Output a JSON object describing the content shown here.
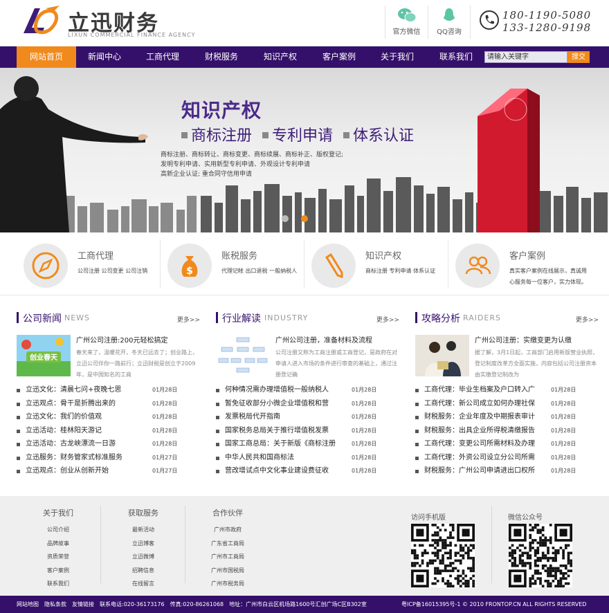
{
  "header": {
    "logo_title": "立迅财务",
    "logo_sub": "LIXUN COMMERCIAL FINANCE AGENCY",
    "wechat_label": "官方微信",
    "qq_label": "QQ咨询",
    "phone1": "180-1190-5080",
    "phone2": "133-1280-9198"
  },
  "nav": {
    "items": [
      "网站首页",
      "新闻中心",
      "工商代理",
      "财税服务",
      "知识产权",
      "客户案例",
      "关于我们",
      "联系我们"
    ],
    "search_placeholder": "请输入关键字",
    "search_button": "搜交"
  },
  "banner": {
    "title": "知识产权",
    "subtitle_items": [
      "商标注册",
      "专利申请",
      "体系认证"
    ],
    "lines": [
      "商标注册、商标转让、商标变更、商标续展、商标补正、版权登记;",
      "发明专利申请、实用新型专利申请、外观设计专利申请",
      "高新企业认证; 重合同守信用申请"
    ],
    "big_number": "1"
  },
  "services": [
    {
      "title": "工商代理",
      "desc": "公司注册 公司变更 公司注销"
    },
    {
      "title": "账税服务",
      "desc": "代理记帐 出口退税 一般纳税人"
    },
    {
      "title": "知识产权",
      "desc": "商标注册 专利申请 体系认证"
    },
    {
      "title": "客户案例",
      "desc": "真实客户案例在线展示，真诚用心服务每一位客户，实力体现。"
    }
  ],
  "columns": [
    {
      "title": "公司新闻",
      "en": "NEWS",
      "more": "更多>>",
      "feature_title": "广州公司注册:200元轻松搞定",
      "feature_desc": "春天来了，温暖花开，冬天已远去了；创业路上，立迅公司伴你一路前行；立迅财税是创立于2009年，是中国知名的工商",
      "feature_img_text": "创业春天",
      "items": [
        {
          "t": "立迅文化：清晨七问+夜晚七思",
          "d": "01月28日"
        },
        {
          "t": "立迅观点：骨干是折腾出来的",
          "d": "01月28日"
        },
        {
          "t": "立迅文化：我们的价值观",
          "d": "01月28日"
        },
        {
          "t": "立迅活动：桂林阳天游记",
          "d": "01月28日"
        },
        {
          "t": "立迅活动：古龙峡漂流一日游",
          "d": "01月28日"
        },
        {
          "t": "立迅服务：财务管家式标准服务",
          "d": "01月27日"
        },
        {
          "t": "立迅观点：创业从创新开始",
          "d": "01月27日"
        }
      ]
    },
    {
      "title": "行业解读",
      "en": "INDUSTRY",
      "more": "更多>>",
      "feature_title": "广州公司注册，准备材料及流程",
      "feature_desc": "公司注册又称为工商注册或工商登记，是政府在对申请人进入市场的条件进行审查的基础上，通过注册登记确",
      "items": [
        {
          "t": "何种情况需办理增值税一般纳税人",
          "d": "01月28日"
        },
        {
          "t": "暂免征收部分小微企业增值税和营",
          "d": "01月28日"
        },
        {
          "t": "发票税局代开指南",
          "d": "01月28日"
        },
        {
          "t": "国家税务总局关于推行增值税发票",
          "d": "01月28日"
        },
        {
          "t": "国家工商总局：关于新版《商标注册",
          "d": "01月28日"
        },
        {
          "t": "中华人民共和国商标法",
          "d": "01月28日"
        },
        {
          "t": "营改增试点中文化事业建设费征收",
          "d": "01月28日"
        }
      ]
    },
    {
      "title": "攻略分析",
      "en": "RAIDERS",
      "more": "更多>>",
      "feature_title": "广州公司注册：实缴变更为认缴",
      "feature_desc": "据了解，3月1日起，工商部门启用新版营业执照，登记制度改革方全面实施，内容包括公司注册资本由实缴登记制改为",
      "items": [
        {
          "t": "工商代理：毕业生档案及户口转入广",
          "d": "01月28日"
        },
        {
          "t": "工商代理：新公司成立如何办理社保",
          "d": "01月28日"
        },
        {
          "t": "财税服务：企业年度及中期报表审计",
          "d": "01月28日"
        },
        {
          "t": "财税服务：出具企业所得税清缴报告",
          "d": "01月28日"
        },
        {
          "t": "工商代理：变更公司所需材料及办理",
          "d": "01月28日"
        },
        {
          "t": "工商代理：外资公司设立分公司所需",
          "d": "01月28日"
        },
        {
          "t": "财税服务：广州公司申请进出口权所",
          "d": "01月28日"
        }
      ]
    }
  ],
  "footer": {
    "cols": [
      {
        "h": "关于我们",
        "items": [
          "公司介绍",
          "品牌故事",
          "资质荣誉",
          "客户案例",
          "联系我们"
        ]
      },
      {
        "h": "获取服务",
        "items": [
          "最新活动",
          "立迅博客",
          "立迅微博",
          "招聘信息",
          "在线留言"
        ]
      },
      {
        "h": "合作伙伴",
        "items": [
          "广州市政府",
          "广东省工商局",
          "广州市工商局",
          "广州市国税局",
          "广州市税务局"
        ]
      }
    ],
    "qr1_label": "访问手机版",
    "qr2_label": "微信公众号"
  },
  "bottombar": {
    "left_items": [
      "网站地图",
      "隐私条款",
      "友情链接",
      "联系电话:020-36173176",
      "传真:020-86261068",
      "地址：广州市白云区机场路1600号汇创广场C区B302室"
    ],
    "right": "粤ICP备16015395号-1 © 2010 FRONTOP.CN ALL RIGHTS RESERVED"
  },
  "colors": {
    "brand_purple": "#34106a",
    "accent_orange": "#f08a1c"
  }
}
